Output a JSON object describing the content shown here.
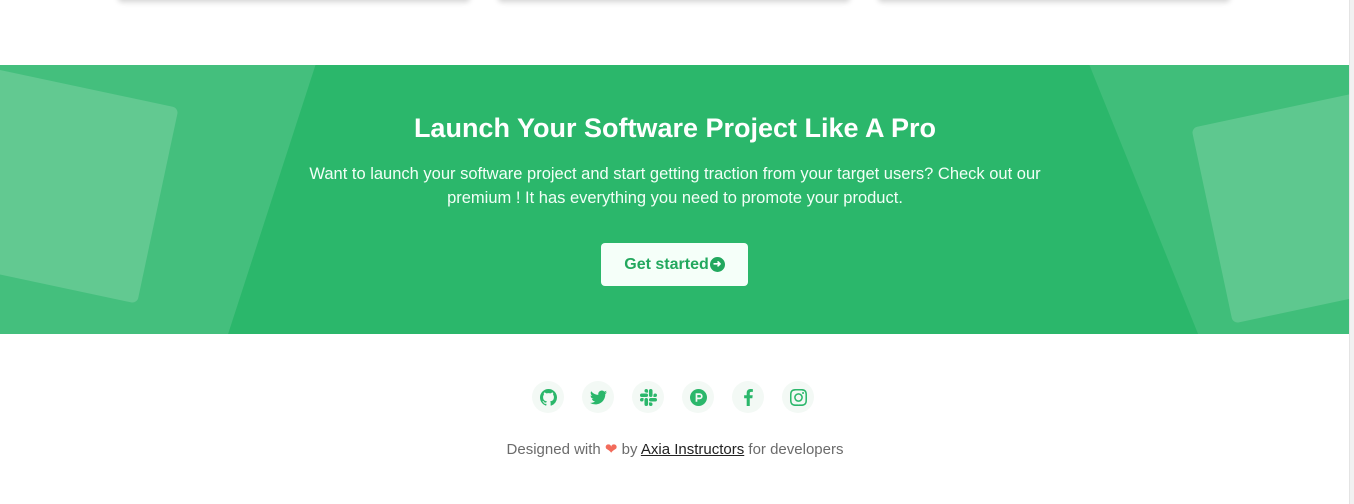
{
  "cta": {
    "title": "Launch Your Software Project Like A Pro",
    "text": "Want to launch your software project and start getting traction from your target users? Check out our premium ! It has everything you need to promote your product.",
    "button_label": "Get started",
    "accent_color": "#2bb76b"
  },
  "social": {
    "icons": [
      "github-icon",
      "twitter-icon",
      "slack-icon",
      "producthunt-icon",
      "facebook-icon",
      "instagram-icon"
    ]
  },
  "footer": {
    "prefix": "Designed with",
    "heart": "❤",
    "by": "by",
    "author_link": "Axia Instructors",
    "suffix": "for developers"
  }
}
